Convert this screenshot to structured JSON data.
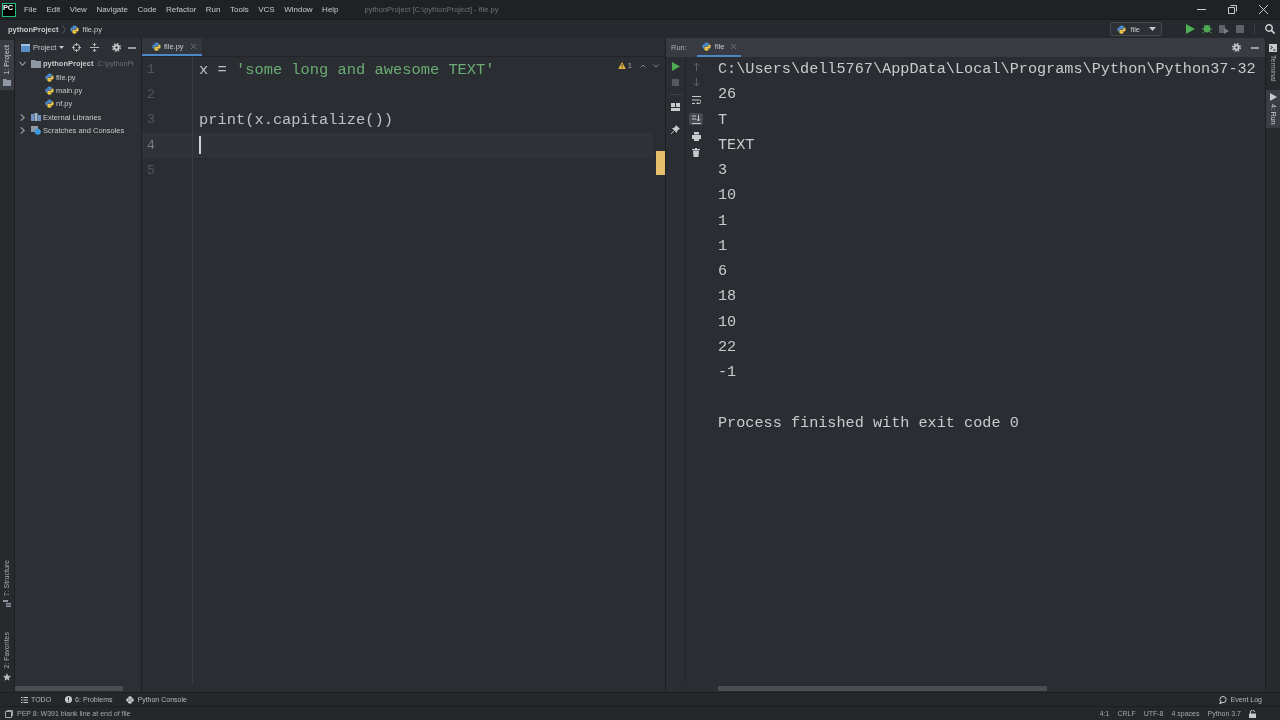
{
  "title_bar": {
    "logo": "PC",
    "menu": [
      "File",
      "Edit",
      "View",
      "Navigate",
      "Code",
      "Refactor",
      "Run",
      "Tools",
      "VCS",
      "Window",
      "Help"
    ],
    "title": "pythonProject [C:\\pythonProject] - file.py"
  },
  "nav_bar": {
    "breadcrumbs": [
      {
        "label": "pythonProject",
        "kind": "project"
      },
      {
        "label": "file.py",
        "kind": "python-file"
      }
    ],
    "run_config": "file"
  },
  "left_stripe": {
    "top": [
      {
        "label": "1: Project",
        "kind": "project",
        "selected": true
      }
    ],
    "bottom": [
      {
        "label": "7: Structure",
        "kind": "structure",
        "selected": false
      },
      {
        "label": "2: Favorites",
        "kind": "favorites",
        "selected": false
      }
    ]
  },
  "project_panel": {
    "title": "Project",
    "tree": [
      {
        "label": "pythonProject",
        "path": "C:\\pythonPr",
        "kind": "folder",
        "expanded": true,
        "children": [
          {
            "label": "file.py",
            "kind": "python-file"
          },
          {
            "label": "main.py",
            "kind": "python-file"
          },
          {
            "label": "nf.py",
            "kind": "python-file"
          }
        ]
      },
      {
        "label": "External Libraries",
        "kind": "library",
        "expanded": false
      },
      {
        "label": "Scratches and Consoles",
        "kind": "scratches",
        "expanded": false
      }
    ]
  },
  "editor": {
    "tabs": [
      {
        "label": "file.py",
        "selected": true
      }
    ],
    "warning_count": "1",
    "lines": [
      {
        "number": "1",
        "current": false,
        "tokens": [
          {
            "text": "x = ",
            "kind": "plain"
          },
          {
            "text": "'some long and awesome TEXT'",
            "kind": "string"
          }
        ]
      },
      {
        "number": "2",
        "current": false
      },
      {
        "number": "3",
        "current": false,
        "tokens": [
          {
            "text": "print(x.capitalize())",
            "kind": "plain"
          }
        ]
      },
      {
        "number": "4",
        "current": true
      },
      {
        "number": "5",
        "current": false
      }
    ]
  },
  "run_panel": {
    "title": "Run:",
    "tabs": [
      {
        "label": "file",
        "selected": true
      }
    ],
    "toggles": [
      {
        "kind": "soft-wrap",
        "on": false
      },
      {
        "kind": "scroll-to-end",
        "on": true
      }
    ],
    "output": [
      "C:\\Users\\dell5767\\AppData\\Local\\Programs\\Python\\Python37-32",
      "26",
      "T",
      "TEXT",
      "3",
      "10",
      "1",
      "1",
      "6",
      "18",
      "10",
      "22",
      "-1"
    ],
    "exit_message": "Process finished with exit code 0"
  },
  "right_stripe": [
    {
      "label": "Terminal",
      "kind": "terminal",
      "selected": false
    },
    {
      "label": "4: Run",
      "kind": "run",
      "selected": true
    }
  ],
  "bottom_tools": [
    {
      "label": "TODO",
      "kind": "todo"
    },
    {
      "label": "6: Problems",
      "kind": "problems"
    },
    {
      "label": "Python Console",
      "kind": "console"
    }
  ],
  "event_log": "Event Log",
  "status_bar": {
    "message": "PEP 8: W391 blank line at end of file",
    "items": [
      "4:1",
      "CRLF",
      "UTF-8",
      "4 spaces",
      "Python 3.7"
    ]
  }
}
